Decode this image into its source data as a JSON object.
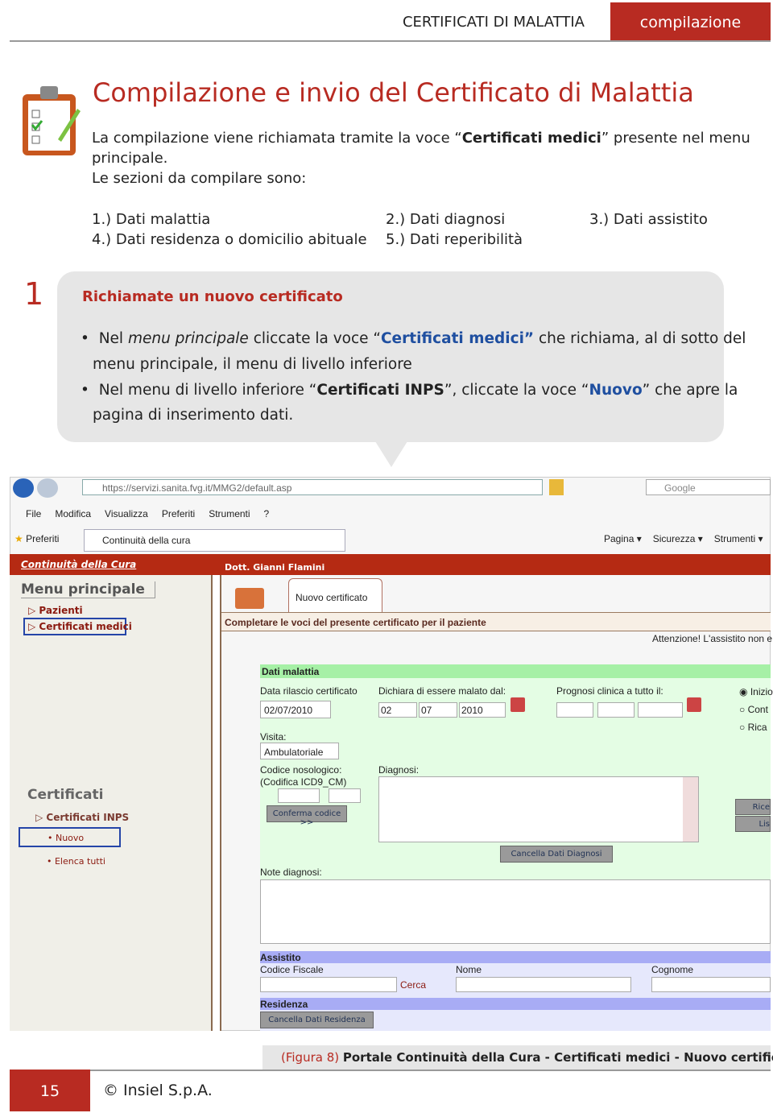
{
  "header": {
    "section": "CERTIFICATI DI MALATTIA",
    "tab": "compilazione",
    "accent": "#b82b22"
  },
  "title": "Compilazione e invio del Certificato di Malattia",
  "intro": {
    "p1_pre": "La compilazione viene richiamata tramite la voce “",
    "p1_bold": "Certificati medici",
    "p1_post": "” presente nel menu",
    "p1_line2": "principale.",
    "p2": "Le sezioni da compilare sono:"
  },
  "sections": [
    "1.)  Dati malattia",
    "2.)  Dati diagnosi",
    "3.)  Dati assistito",
    "4.)  Dati residenza o domicilio abituale",
    "5.)  Dati reperibilità"
  ],
  "step": {
    "number": "1",
    "title": "Richiamate un nuovo certificato",
    "b1": {
      "a": "Nel ",
      "i": "menu principale",
      "b": " cliccate la voce “",
      "c": "Certificati medici”",
      "d": " che richiama, al di sotto del",
      "l2": "menu principale, il menu di livello inferiore"
    },
    "b2": {
      "a": "Nel menu di livello inferiore “",
      "b": "Certificati INPS",
      "c": "”, cliccate la voce “",
      "d": "Nuovo",
      "e": "”  che apre la",
      "l2": "pagina di inserimento dati."
    }
  },
  "browser": {
    "url": "https://servizi.sanita.fvg.it/MMG2/default.asp",
    "search": "Google",
    "menu": [
      "File",
      "Modifica",
      "Visualizza",
      "Preferiti",
      "Strumenti",
      "?"
    ],
    "favorites": "Preferiti",
    "tab": "Continuità della cura",
    "tools": [
      "Pagina ▾",
      "Sicurezza ▾",
      "Strumenti ▾"
    ]
  },
  "app": {
    "brand": "Continuità della Cura",
    "user": "Dott. Gianni Flamini",
    "menu_title": "Menu principale",
    "menu_items": [
      "Pazienti",
      "Certificati medici"
    ],
    "cert_title": "Certificati",
    "cert_items": [
      "Certificati INPS",
      "• Nuovo",
      "• Elenca tutti"
    ],
    "tab": "Nuovo certificato",
    "instruction": "Completare le voci del presente certificato per il paziente",
    "warning": "Attenzione! L'assistito non e",
    "dati_malattia": "Dati malattia",
    "data_rilascio_label": "Data rilascio certificato",
    "data_rilascio": "02/07/2010",
    "malato_label": "Dichiara di essere malato dal:",
    "malato": [
      "02",
      "07",
      "2010"
    ],
    "prognosi_label": "Prognosi clinica a tutto il:",
    "radios": [
      "Inizio",
      "Cont",
      "Rica"
    ],
    "visita_label": "Visita:",
    "visita": "Ambulatoriale",
    "codice_label": "Codice nosologico:",
    "codifica_label": "(Codifica ICD9_CM)",
    "conferma": "Conferma codice >>",
    "diagnosi_label": "Diagnosi:",
    "side_buttons": [
      "Rice",
      "Lis"
    ],
    "cancella_diagnosi": "Cancella Dati Diagnosi",
    "note_label": "Note diagnosi:",
    "assistito": "Assistito",
    "cf_label": "Codice Fiscale",
    "cerca": "Cerca",
    "nome_label": "Nome",
    "cognome_label": "Cognome",
    "residenza": "Residenza",
    "cancella_residenza": "Cancella Dati Residenza"
  },
  "caption": {
    "prefix": "(Figura 8) ",
    "text": "Portale Continuità della Cura - Certificati medici - Nuovo certificato"
  },
  "footer": {
    "page": "15",
    "copyright": "© Insiel S.p.A."
  }
}
